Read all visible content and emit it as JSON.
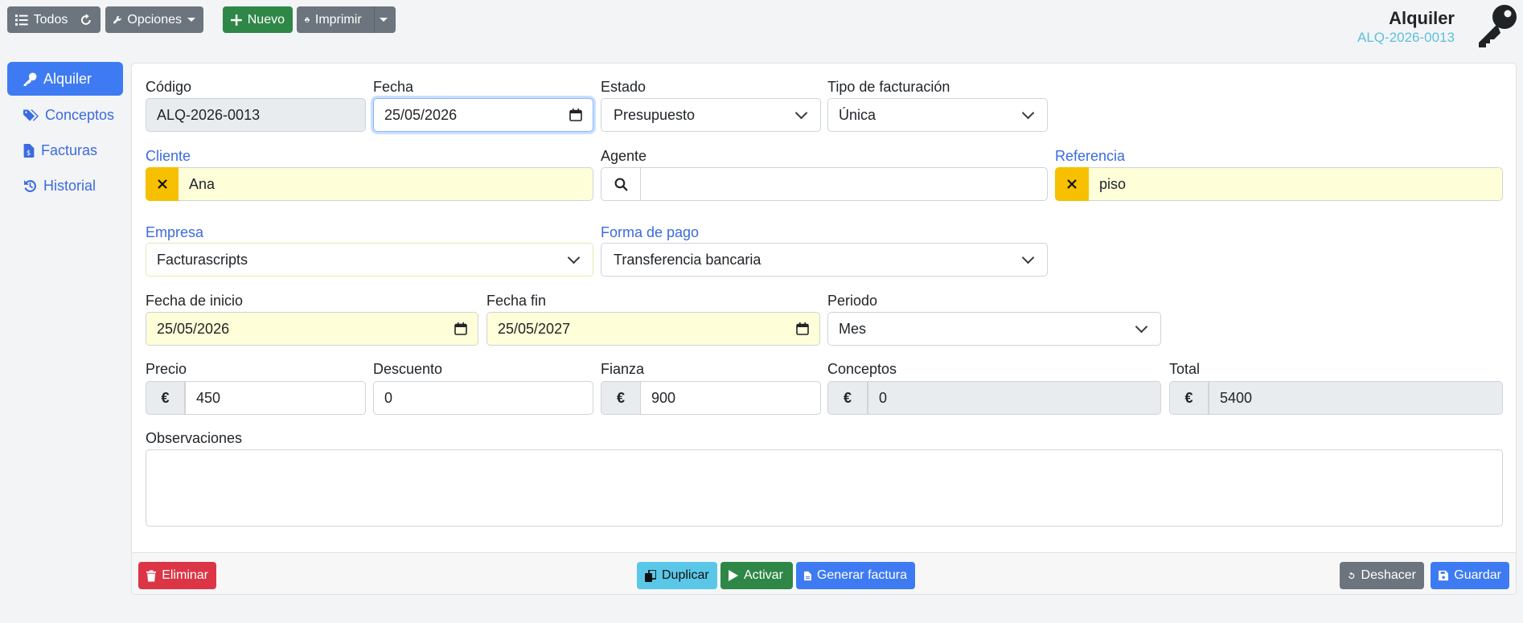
{
  "toolbar": {
    "all_label": "Todos",
    "options_label": "Opciones",
    "new_label": "Nuevo",
    "print_label": "Imprimir"
  },
  "header": {
    "title": "Alquiler",
    "code": "ALQ-2026-0013",
    "icon": "key-icon"
  },
  "sidebar": {
    "items": [
      {
        "label": "Alquiler",
        "icon": "key-icon",
        "active": true
      },
      {
        "label": "Conceptos",
        "icon": "tags-icon"
      },
      {
        "label": "Facturas",
        "icon": "invoice-icon"
      },
      {
        "label": "Historial",
        "icon": "history-icon"
      }
    ]
  },
  "form": {
    "codigo": {
      "label": "Código",
      "value": "ALQ-2026-0013"
    },
    "fecha": {
      "label": "Fecha",
      "value": "25/05/2026"
    },
    "estado": {
      "label": "Estado",
      "value": "Presupuesto"
    },
    "tipo_facturacion": {
      "label": "Tipo de facturación",
      "value": "Única"
    },
    "cliente": {
      "label": "Cliente",
      "value": "Ana"
    },
    "agente": {
      "label": "Agente",
      "value": ""
    },
    "referencia": {
      "label": "Referencia",
      "value": "piso"
    },
    "empresa": {
      "label": "Empresa",
      "value": "Facturascripts"
    },
    "forma_pago": {
      "label": "Forma de pago",
      "value": "Transferencia bancaria"
    },
    "fecha_inicio": {
      "label": "Fecha de inicio",
      "value": "25/05/2026"
    },
    "fecha_fin": {
      "label": "Fecha fin",
      "value": "25/05/2027"
    },
    "periodo": {
      "label": "Periodo",
      "value": "Mes"
    },
    "precio": {
      "label": "Precio",
      "value": "450"
    },
    "descuento": {
      "label": "Descuento",
      "value": "0"
    },
    "fianza": {
      "label": "Fianza",
      "value": "900"
    },
    "conceptos": {
      "label": "Conceptos",
      "value": "0"
    },
    "total": {
      "label": "Total",
      "value": "5400"
    },
    "observaciones": {
      "label": "Observaciones",
      "value": ""
    },
    "currency": "€"
  },
  "footer": {
    "delete_label": "Eliminar",
    "duplicate_label": "Duplicar",
    "activate_label": "Activar",
    "invoice_label": "Generar factura",
    "undo_label": "Deshacer",
    "save_label": "Guardar"
  },
  "colors": {
    "primary": "#3e7bf2",
    "success": "#2f8747",
    "danger": "#dc3545",
    "warning": "#f6c000",
    "info": "#5bc7e8",
    "secondary": "#6c757d"
  }
}
